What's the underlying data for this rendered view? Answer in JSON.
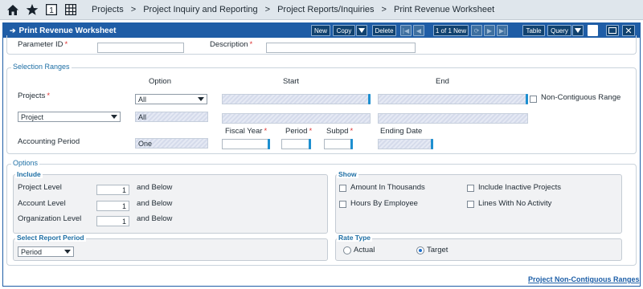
{
  "nav": {
    "breadcrumbs": [
      "Projects",
      "Project Inquiry and Reporting",
      "Project Reports/Inquiries",
      "Print Revenue Worksheet"
    ],
    "icons": [
      "home-icon",
      "star-icon",
      "number-one-icon",
      "grid-icon"
    ],
    "one_label": "1"
  },
  "window": {
    "title": "Print Revenue Worksheet",
    "toolbar": {
      "new": "New",
      "copy": "Copy",
      "delete": "Delete",
      "record_count": "1 of 1 New",
      "table": "Table",
      "query": "Query"
    }
  },
  "header": {
    "param_id_label": "Parameter ID",
    "param_id_value": "",
    "description_label": "Description",
    "description_value": ""
  },
  "selection": {
    "legend": "Selection Ranges",
    "col_option": "Option",
    "col_start": "Start",
    "col_end": "End",
    "projects_label": "Projects",
    "projects_option": "All",
    "non_contiguous_label": "Non-Contiguous Range",
    "project_select": "Project",
    "project_option": "All",
    "accounting_period_label": "Accounting Period",
    "accounting_option": "One",
    "fiscal_year_label": "Fiscal Year",
    "period_label": "Period",
    "subpd_label": "Subpd",
    "ending_date_label": "Ending Date"
  },
  "options": {
    "legend": "Options",
    "include": {
      "legend": "Include",
      "project_level_label": "Project Level",
      "project_level_value": "1",
      "account_level_label": "Account Level",
      "account_level_value": "1",
      "org_level_label": "Organization Level",
      "org_level_value": "1",
      "and_below": "and Below"
    },
    "show": {
      "legend": "Show",
      "amount_thousands": "Amount In Thousands",
      "include_inactive": "Include Inactive Projects",
      "hours_by_employee": "Hours By Employee",
      "lines_no_activity": "Lines With No Activity"
    },
    "report_period": {
      "legend": "Select Report Period",
      "value": "Period"
    },
    "rate_type": {
      "legend": "Rate Type",
      "actual": "Actual",
      "target": "Target",
      "selected": "Target"
    }
  },
  "footer_link": "Project Non-Contiguous Ranges",
  "colors": {
    "title_bar": "#1f5da6",
    "nav_bg": "#dfe6ec",
    "legend_text": "#1e6fa5",
    "required": "#d33",
    "accent_tick": "#1d8fd0"
  }
}
